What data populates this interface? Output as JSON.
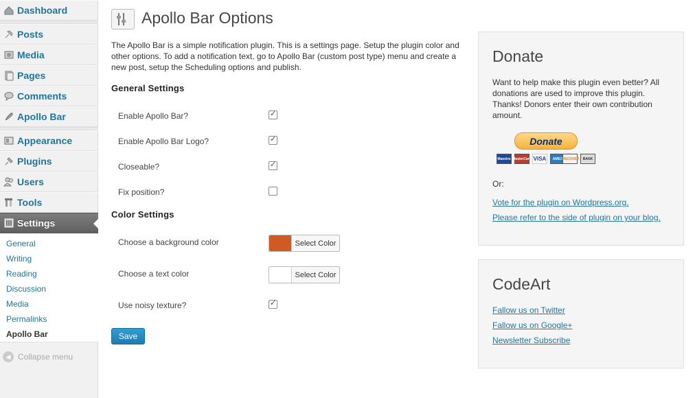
{
  "sidebar": {
    "items": [
      {
        "label": "Dashboard",
        "icon": "dashboard-icon"
      },
      {
        "label": "Posts",
        "icon": "pin-icon"
      },
      {
        "label": "Media",
        "icon": "media-icon"
      },
      {
        "label": "Pages",
        "icon": "pages-icon"
      },
      {
        "label": "Comments",
        "icon": "comment-icon"
      },
      {
        "label": "Apollo Bar",
        "icon": "rocket-icon"
      },
      {
        "label": "Appearance",
        "icon": "appearance-icon"
      },
      {
        "label": "Plugins",
        "icon": "plug-icon"
      },
      {
        "label": "Users",
        "icon": "users-icon"
      },
      {
        "label": "Tools",
        "icon": "tools-icon"
      },
      {
        "label": "Settings",
        "icon": "settings-icon"
      }
    ],
    "submenu": [
      "General",
      "Writing",
      "Reading",
      "Discussion",
      "Media",
      "Permalinks",
      "Apollo Bar"
    ],
    "collapse_label": "Collapse menu"
  },
  "main": {
    "title": "Apollo Bar Options",
    "intro": "The Apollo Bar is a simple notification plugin. This is a settings page. Setup the plugin color and other options. To add a notification text, go to Apollo Bar (custom post type) menu and create a new post, setup the Scheduling options and publish.",
    "general_heading": "General Settings",
    "general_options": [
      {
        "label": "Enable Apollo Bar?",
        "checked": true
      },
      {
        "label": "Enable Apollo Bar Logo?",
        "checked": true
      },
      {
        "label": "Closeable?",
        "checked": true
      },
      {
        "label": "Fix position?",
        "checked": false
      }
    ],
    "color_heading": "Color Settings",
    "bg_color_label": "Choose a background color",
    "bg_color_value": "#d05a24",
    "text_color_label": "Choose a text color",
    "text_color_value": "#ffffff",
    "select_color_label": "Select Color",
    "noisy_label": "Use noisy texture?",
    "noisy_checked": true,
    "save_label": "Save"
  },
  "donate_box": {
    "title": "Donate",
    "text": "Want to help make this plugin even better? All donations are used to improve this plugin. Thanks! Donors enter their own contribution amount.",
    "button_label": "Donate",
    "cards": [
      "Maestro",
      "MasterCard",
      "VISA",
      "AMEX",
      "DISCOVER",
      "BANK"
    ],
    "or_label": "Or:",
    "link1": "Vote for the plugin on Wordpress.org.",
    "link2": "Please refer to the side of plugin on your blog."
  },
  "codeart_box": {
    "title": "CodeArt",
    "links": [
      "Fallow us on Twitter",
      "Fallow us on Google+",
      "Newsletter Subscribe"
    ]
  },
  "colors": {
    "link": "#21759b",
    "active_menu": "#6d6d6d",
    "save_button": "#2584be"
  }
}
